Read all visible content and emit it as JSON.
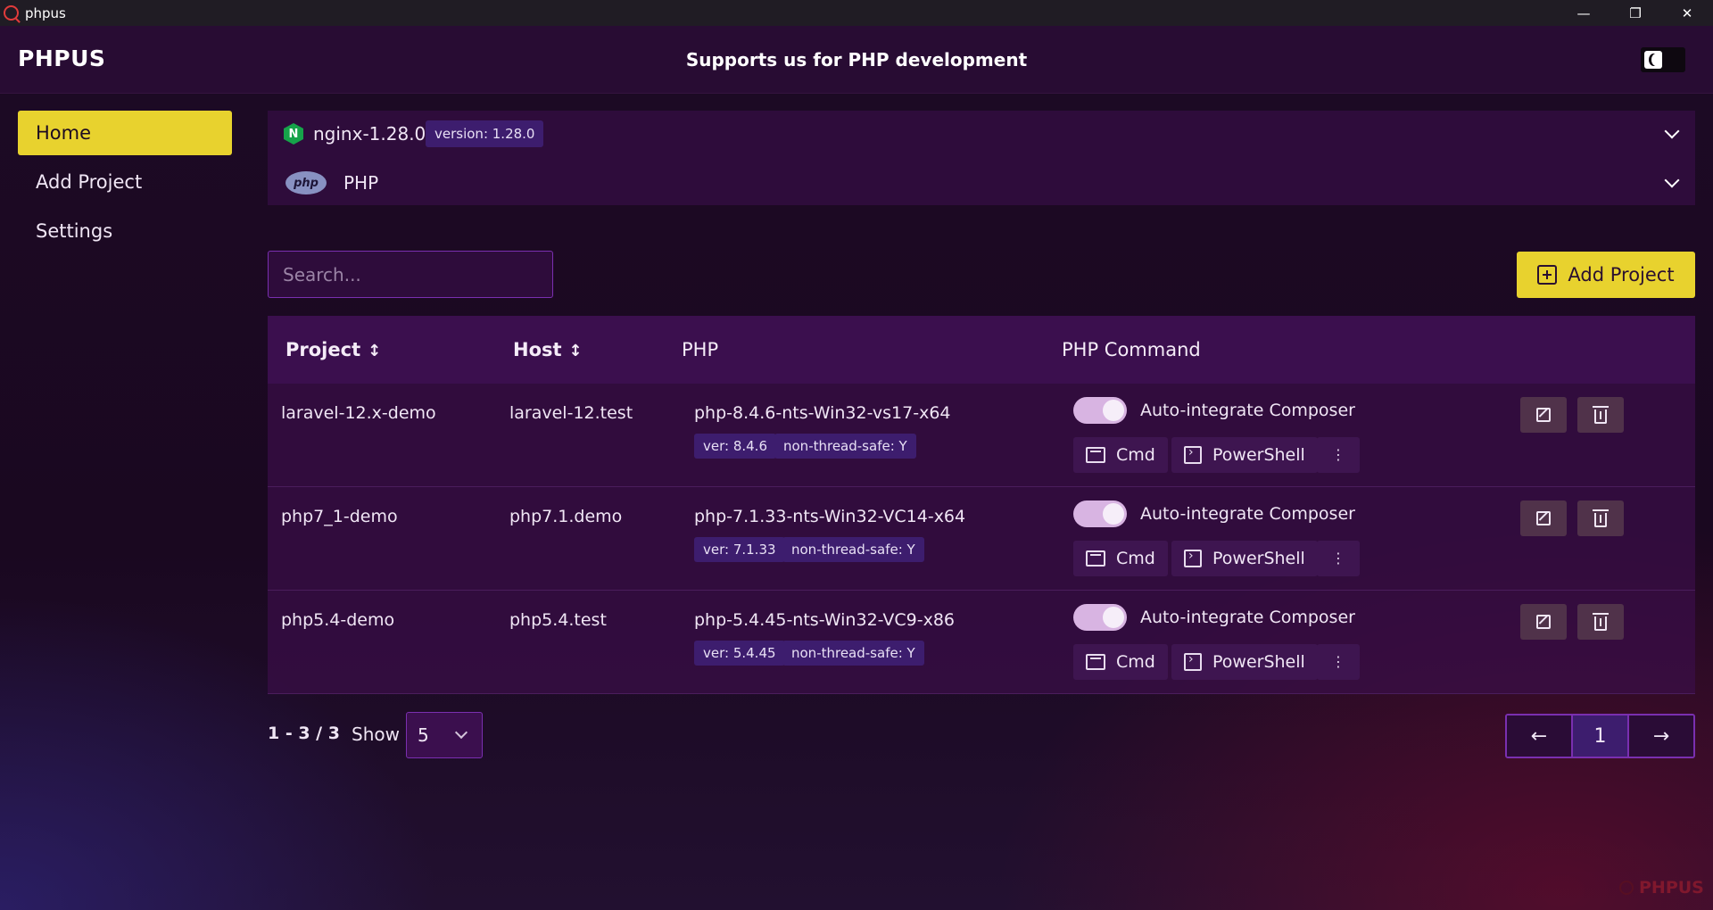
{
  "window": {
    "title": "phpus",
    "controls": [
      "minimize",
      "restore",
      "close"
    ]
  },
  "header": {
    "logo": "PHPUS",
    "tagline": "Supports us for PHP development",
    "theme_icon": "moon-icon"
  },
  "sidebar": {
    "items": [
      {
        "label": "Home",
        "active": true
      },
      {
        "label": "Add Project",
        "active": false
      },
      {
        "label": "Settings",
        "active": false
      }
    ]
  },
  "services": [
    {
      "icon": "nginx-icon",
      "icon_text": "N",
      "name": "nginx-1.28.0",
      "badge": "version: 1.28.0"
    },
    {
      "icon": "php-logo-icon",
      "icon_text": "php",
      "name": "PHP",
      "badge": ""
    }
  ],
  "toolbar": {
    "search_placeholder": "Search...",
    "search_value": "",
    "add_label": "Add Project"
  },
  "table": {
    "headers": {
      "project": "Project",
      "host": "Host",
      "php": "PHP",
      "command": "PHP Command"
    },
    "rows": [
      {
        "project": "laravel-12.x-demo",
        "host": "laravel-12.test",
        "php": "php-8.4.6-nts-Win32-vs17-x64",
        "ver": "ver: 8.4.6",
        "nts": "non-thread-safe: Y",
        "composer_label": "Auto-integrate Composer",
        "composer_on": true,
        "cmd": "Cmd",
        "powershell": "PowerShell"
      },
      {
        "project": "php7_1-demo",
        "host": "php7.1.demo",
        "php": "php-7.1.33-nts-Win32-VC14-x64",
        "ver": "ver: 7.1.33",
        "nts": "non-thread-safe: Y",
        "composer_label": "Auto-integrate Composer",
        "composer_on": true,
        "cmd": "Cmd",
        "powershell": "PowerShell"
      },
      {
        "project": "php5.4-demo",
        "host": "php5.4.test",
        "php": "php-5.4.45-nts-Win32-VC9-x86",
        "ver": "ver: 5.4.45",
        "nts": "non-thread-safe: Y",
        "composer_label": "Auto-integrate Composer",
        "composer_on": true,
        "cmd": "Cmd",
        "powershell": "PowerShell"
      }
    ]
  },
  "footer": {
    "range": "1 - 3 / 3",
    "show_label": "Show",
    "page_size": "5",
    "pager": {
      "prev": "←",
      "current": "1",
      "next": "→"
    },
    "watermark": "PHPUS"
  },
  "colors": {
    "accent": "#e8d22e",
    "header_bg": "#280c33",
    "table_header_bg": "#3b0f4e",
    "badge_bg": "#3d1d6e",
    "border_purple": "#7a2fb0"
  }
}
